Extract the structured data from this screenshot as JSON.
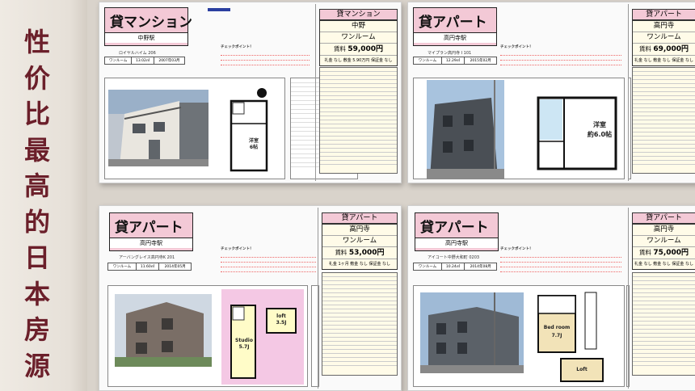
{
  "side_title": "性价比最高的日本房源",
  "listings": [
    {
      "type": "貸マンション",
      "station": "中野駅",
      "building": "ロイヤルハイム 206",
      "layout_cell": "ワンルーム",
      "area_cell": "13.02㎡",
      "year_cell": "2007年03月",
      "header_type": "貸マンション",
      "area_name": "中野",
      "room": "ワンルーム",
      "rent_label": "賃料",
      "rent": "59,000円",
      "terms": "礼金 なし  敷金 5.90万円  保証金 なし",
      "point_label": "チェックポイント！",
      "plan_room": "洋室",
      "plan_size": "6帖"
    },
    {
      "type": "貸アパート",
      "station": "高円寺駅",
      "building": "マイプラン高円寺 I 101",
      "layout_cell": "ワンルーム",
      "area_cell": "12.29㎡",
      "year_cell": "2015年02月",
      "header_type": "貸アパート",
      "area_name": "高円寺",
      "room": "ワンルーム",
      "rent_label": "賃料",
      "rent": "69,000円",
      "terms": "礼金 なし  敷金 なし  保証金 なし",
      "point_label": "チェックポイント！",
      "plan_room": "洋室",
      "plan_size": "約6.0帖"
    },
    {
      "type": "貸アパート",
      "station": "高円寺駅",
      "building": "アーバングレイス高円寺K 201",
      "layout_cell": "ワンルーム",
      "area_cell": "11.60㎡",
      "year_cell": "2014年05月",
      "header_type": "貸アパート",
      "area_name": "高円寺",
      "room": "ワンルーム",
      "rent_label": "賃料",
      "rent": "53,000円",
      "terms": "礼金 1ヶ月  敷金 なし  保証金 なし",
      "point_label": "チェックポイント！",
      "plan_room": "Studio",
      "plan_size": "5.7J",
      "loft": "loft",
      "loft_size": "3.5J"
    },
    {
      "type": "貸アパート",
      "station": "高円寺駅",
      "building": "アイコート中野大和町 0203",
      "layout_cell": "ワンルーム",
      "area_cell": "10.24㎡",
      "year_cell": "2014年08月",
      "header_type": "貸アパート",
      "area_name": "高円寺",
      "room": "ワンルーム",
      "rent_label": "賃料",
      "rent": "75,000円",
      "terms": "礼金 なし  敷金 なし  保証金 なし",
      "point_label": "チェックポイント！",
      "plan_room": "Bed room",
      "plan_size": "7.7J",
      "loft": "Loft"
    }
  ]
}
